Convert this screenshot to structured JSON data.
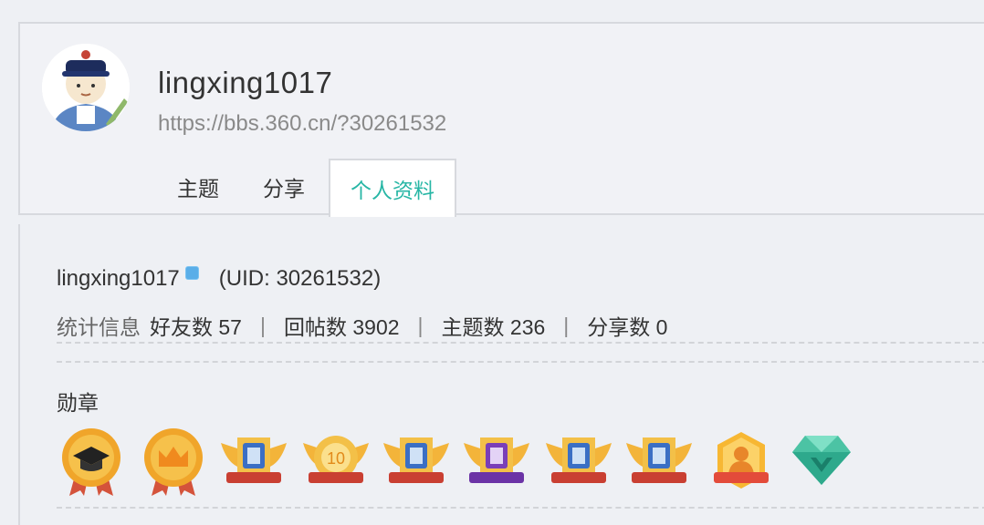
{
  "profile": {
    "username": "lingxing1017",
    "url": "https://bbs.360.cn/?30261532"
  },
  "tabs": [
    {
      "label": "主题"
    },
    {
      "label": "分享"
    },
    {
      "label": "个人资料"
    }
  ],
  "info": {
    "username": "lingxing1017",
    "uid": "(UID: 30261532)"
  },
  "stats": {
    "label": "统计信息",
    "friends": "好友数 57",
    "replies": "回帖数 3902",
    "topics": "主题数 236",
    "shares": "分享数 0"
  },
  "medals": {
    "title": "勋章",
    "items": [
      {
        "icon": "graduation-cap-medal-icon"
      },
      {
        "icon": "crown-medal-icon"
      },
      {
        "icon": "winged-badge-blue-icon"
      },
      {
        "icon": "winged-badge-gold-icon"
      },
      {
        "icon": "winged-badge-blue-icon"
      },
      {
        "icon": "winged-badge-purple-icon"
      },
      {
        "icon": "winged-badge-blue-icon"
      },
      {
        "icon": "winged-badge-blue-icon"
      },
      {
        "icon": "shield-person-badge-icon"
      },
      {
        "icon": "diamond-icon"
      }
    ]
  },
  "colors": {
    "accent": "#27b6a5",
    "background": "#eef0f4",
    "text": "#333333"
  }
}
